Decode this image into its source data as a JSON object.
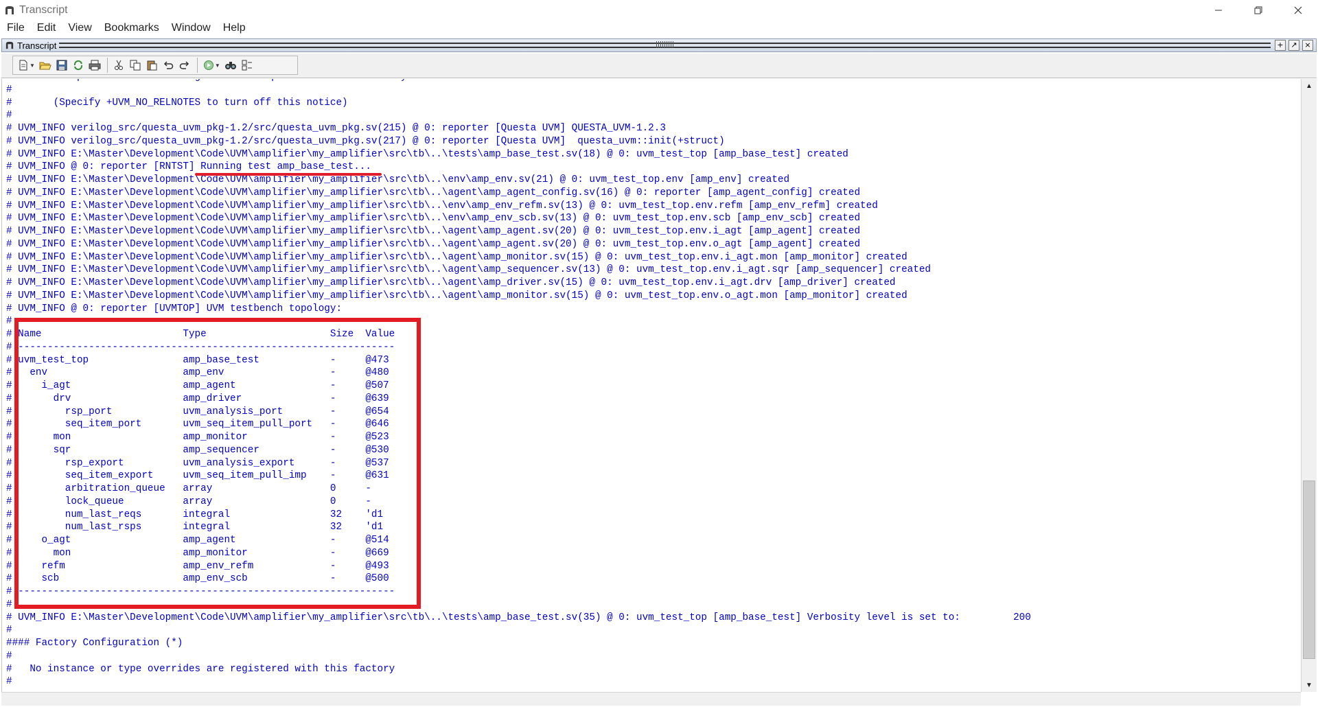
{
  "window": {
    "title": "Transcript",
    "minimize_icon": "minimize-icon",
    "restore_icon": "restore-icon",
    "close_icon": "close-icon"
  },
  "menu": [
    "File",
    "Edit",
    "View",
    "Bookmarks",
    "Window",
    "Help"
  ],
  "pane": {
    "title": "Transcript",
    "buttons": [
      "+",
      "↗",
      "×"
    ]
  },
  "toolbar": {
    "icons": [
      "new-document-icon",
      "open-folder-icon",
      "save-icon",
      "reload-icon",
      "print-icon",
      "cut-icon",
      "copy-icon",
      "paste-icon",
      "undo-icon",
      "redo-icon",
      "run-icon",
      "find-icon",
      "options-icon"
    ]
  },
  "transcript": {
    "lines": [
      "#    See http://www.accellera.org/uvm/ or http://verificationacademy.com for more details.",
      "#",
      "#       (Specify +UVM_NO_RELNOTES to turn off this notice)",
      "#",
      "# UVM_INFO verilog_src/questa_uvm_pkg-1.2/src/questa_uvm_pkg.sv(215) @ 0: reporter [Questa UVM] QUESTA_UVM-1.2.3",
      "# UVM_INFO verilog_src/questa_uvm_pkg-1.2/src/questa_uvm_pkg.sv(217) @ 0: reporter [Questa UVM]  questa_uvm::init(+struct)",
      "# UVM_INFO E:\\Master\\Development\\Code\\UVM\\amplifier\\my_amplifier\\src\\tb\\..\\tests\\amp_base_test.sv(18) @ 0: uvm_test_top [amp_base_test] created",
      "# UVM_INFO @ 0: reporter [RNTST] Running test amp_base_test...",
      "# UVM_INFO E:\\Master\\Development\\Code\\UVM\\amplifier\\my_amplifier\\src\\tb\\..\\env\\amp_env.sv(21) @ 0: uvm_test_top.env [amp_env] created",
      "# UVM_INFO E:\\Master\\Development\\Code\\UVM\\amplifier\\my_amplifier\\src\\tb\\..\\agent\\amp_agent_config.sv(16) @ 0: reporter [amp_agent_config] created",
      "# UVM_INFO E:\\Master\\Development\\Code\\UVM\\amplifier\\my_amplifier\\src\\tb\\..\\env\\amp_env_refm.sv(13) @ 0: uvm_test_top.env.refm [amp_env_refm] created",
      "# UVM_INFO E:\\Master\\Development\\Code\\UVM\\amplifier\\my_amplifier\\src\\tb\\..\\env\\amp_env_scb.sv(13) @ 0: uvm_test_top.env.scb [amp_env_scb] created",
      "# UVM_INFO E:\\Master\\Development\\Code\\UVM\\amplifier\\my_amplifier\\src\\tb\\..\\agent\\amp_agent.sv(20) @ 0: uvm_test_top.env.i_agt [amp_agent] created",
      "# UVM_INFO E:\\Master\\Development\\Code\\UVM\\amplifier\\my_amplifier\\src\\tb\\..\\agent\\amp_agent.sv(20) @ 0: uvm_test_top.env.o_agt [amp_agent] created",
      "# UVM_INFO E:\\Master\\Development\\Code\\UVM\\amplifier\\my_amplifier\\src\\tb\\..\\agent\\amp_monitor.sv(15) @ 0: uvm_test_top.env.i_agt.mon [amp_monitor] created",
      "# UVM_INFO E:\\Master\\Development\\Code\\UVM\\amplifier\\my_amplifier\\src\\tb\\..\\agent\\amp_sequencer.sv(13) @ 0: uvm_test_top.env.i_agt.sqr [amp_sequencer] created",
      "# UVM_INFO E:\\Master\\Development\\Code\\UVM\\amplifier\\my_amplifier\\src\\tb\\..\\agent\\amp_driver.sv(15) @ 0: uvm_test_top.env.i_agt.drv [amp_driver] created",
      "# UVM_INFO E:\\Master\\Development\\Code\\UVM\\amplifier\\my_amplifier\\src\\tb\\..\\agent\\amp_monitor.sv(15) @ 0: uvm_test_top.env.o_agt.mon [amp_monitor] created",
      "# UVM_INFO @ 0: reporter [UVMTOP] UVM testbench topology:",
      "# ----------------------------------------------------------------",
      "# Name                        Type                     Size  Value",
      "# ----------------------------------------------------------------",
      "# uvm_test_top                amp_base_test            -     @473",
      "#   env                       amp_env                  -     @480",
      "#     i_agt                   amp_agent                -     @507",
      "#       drv                   amp_driver               -     @639",
      "#         rsp_port            uvm_analysis_port        -     @654",
      "#         seq_item_port       uvm_seq_item_pull_port   -     @646",
      "#       mon                   amp_monitor              -     @523",
      "#       sqr                   amp_sequencer            -     @530",
      "#         rsp_export          uvm_analysis_export      -     @537",
      "#         seq_item_export     uvm_seq_item_pull_imp    -     @631",
      "#         arbitration_queue   array                    0     -",
      "#         lock_queue          array                    0     -",
      "#         num_last_reqs       integral                 32    'd1",
      "#         num_last_rsps       integral                 32    'd1",
      "#     o_agt                   amp_agent                -     @514",
      "#       mon                   amp_monitor              -     @669",
      "#     refm                    amp_env_refm             -     @493",
      "#     scb                     amp_env_scb              -     @500",
      "# ----------------------------------------------------------------",
      "#",
      "# UVM_INFO E:\\Master\\Development\\Code\\UVM\\amplifier\\my_amplifier\\src\\tb\\..\\tests\\amp_base_test.sv(35) @ 0: uvm_test_top [amp_base_test] Verbosity level is set to:         200",
      "#",
      "#### Factory Configuration (*)",
      "#",
      "#   No instance or type overrides are registered with this factory",
      "#"
    ],
    "text_color": "#0000cc",
    "underline_color": "#e01e2b",
    "highlight_color": "#e31b23"
  },
  "scrollbar": {
    "up_arrow": "▲",
    "down_arrow": "▼"
  }
}
